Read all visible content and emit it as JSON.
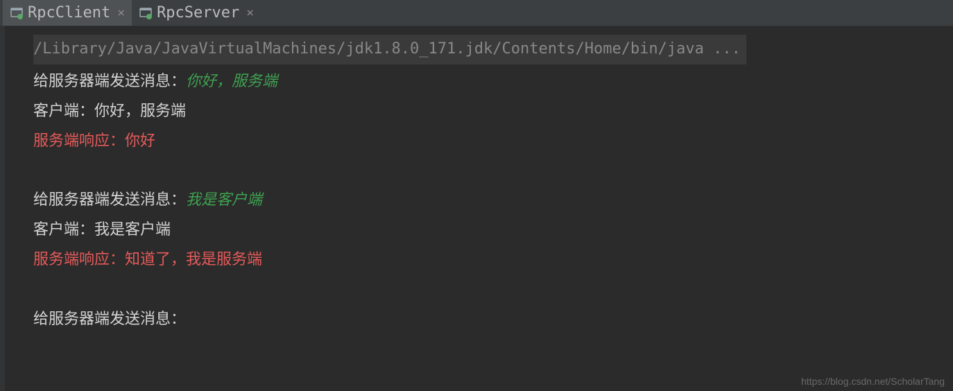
{
  "tabs": [
    {
      "label": "RpcClient",
      "active": true
    },
    {
      "label": "RpcServer",
      "active": false
    }
  ],
  "console": {
    "command": "/Library/Java/JavaVirtualMachines/jdk1.8.0_171.jdk/Contents/Home/bin/java ...",
    "lines": [
      {
        "parts": [
          {
            "text": "给服务器端发送消息：",
            "cls": "white"
          },
          {
            "text": "你好，服务端",
            "cls": "green-italic"
          }
        ]
      },
      {
        "parts": [
          {
            "text": "客户端：你好，服务端",
            "cls": "white"
          }
        ]
      },
      {
        "parts": [
          {
            "text": "服务端响应：你好",
            "cls": "red"
          }
        ]
      },
      {
        "parts": [
          {
            "text": "",
            "cls": "white"
          }
        ]
      },
      {
        "parts": [
          {
            "text": "给服务器端发送消息：",
            "cls": "white"
          },
          {
            "text": "我是客户端",
            "cls": "green-italic"
          }
        ]
      },
      {
        "parts": [
          {
            "text": "客户端：我是客户端",
            "cls": "white"
          }
        ]
      },
      {
        "parts": [
          {
            "text": "服务端响应：知道了，我是服务端",
            "cls": "red"
          }
        ]
      },
      {
        "parts": [
          {
            "text": "",
            "cls": "white"
          }
        ]
      },
      {
        "parts": [
          {
            "text": "给服务器端发送消息：",
            "cls": "white"
          }
        ]
      }
    ]
  },
  "watermark": "https://blog.csdn.net/ScholarTang"
}
